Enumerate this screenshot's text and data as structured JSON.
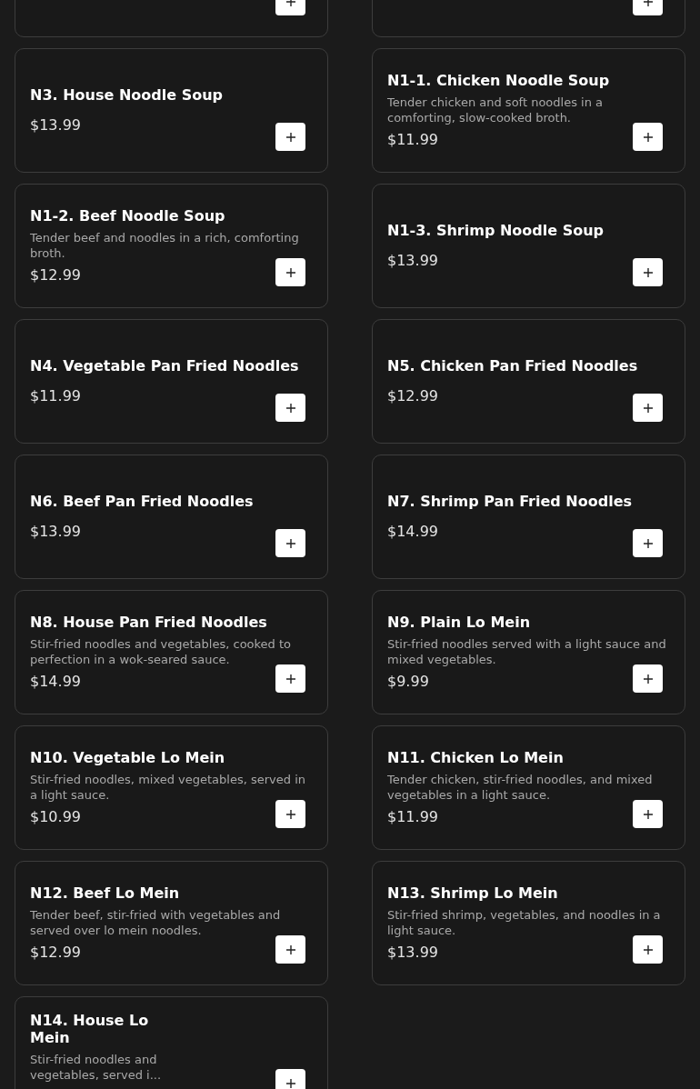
{
  "menu_rows": [
    [
      {
        "kind": "cut"
      },
      {
        "kind": "cut"
      }
    ],
    [
      {
        "kind": "full",
        "name": "N3. House Noodle Soup",
        "price": "$13.99"
      },
      {
        "kind": "full",
        "name": "N1-1. Chicken Noodle Soup",
        "description": "Tender chicken and soft noodles in a comforting, slow-cooked broth.",
        "price": "$11.99"
      }
    ],
    [
      {
        "kind": "full",
        "name": "N1-2. Beef Noodle Soup",
        "description": "Tender beef and noodles in a rich, comforting broth.",
        "price": "$12.99"
      },
      {
        "kind": "full",
        "name": "N1-3. Shrimp Noodle Soup",
        "price": "$13.99"
      }
    ],
    [
      {
        "kind": "full",
        "name": "N4. Vegetable Pan Fried Noodles",
        "price": "$11.99"
      },
      {
        "kind": "full",
        "name": "N5. Chicken Pan Fried Noodles",
        "price": "$12.99"
      }
    ],
    [
      {
        "kind": "full",
        "name": "N6. Beef Pan Fried Noodles",
        "price": "$13.99"
      },
      {
        "kind": "full",
        "name": "N7. Shrimp Pan Fried Noodles",
        "price": "$14.99"
      }
    ],
    [
      {
        "kind": "full",
        "name": "N8. House Pan Fried Noodles",
        "description": "Stir-fried noodles and vegetables, cooked to perfection in a wok-seared sauce.",
        "price": "$14.99"
      },
      {
        "kind": "full",
        "name": "N9. Plain Lo Mein",
        "description": "Stir-fried noodles served with a light sauce and mixed vegetables.",
        "price": "$9.99"
      }
    ],
    [
      {
        "kind": "full",
        "name": "N10. Vegetable Lo Mein",
        "description": "Stir-fried noodles, mixed vegetables, served in a light sauce.",
        "price": "$10.99"
      },
      {
        "kind": "full",
        "name": "N11. Chicken Lo Mein",
        "description": "Tender chicken, stir-fried noodles, and mixed vegetables in a light sauce.",
        "price": "$11.99"
      }
    ],
    [
      {
        "kind": "full",
        "name": "N12. Beef Lo Mein",
        "description": "Tender beef, stir-fried with vegetables and served over lo mein noodles.",
        "price": "$12.99"
      },
      {
        "kind": "full",
        "name": "N13. Shrimp Lo Mein",
        "description": "Stir-fried shrimp, vegetables, and noodles in a light sauce.",
        "price": "$13.99"
      }
    ],
    [
      {
        "kind": "narrow",
        "name": "N14. House Lo Mein",
        "description": "Stir-fried noodles and vegetables, served i..."
      }
    ]
  ]
}
